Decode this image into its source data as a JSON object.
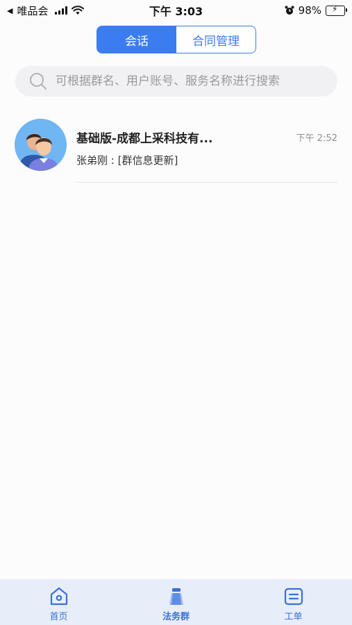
{
  "status_bar": {
    "back_app": "唯品会",
    "time": "下午 3:03",
    "battery": "98%",
    "battery_level": 0.98
  },
  "segmented": {
    "tabs": [
      {
        "label": "会话",
        "active": true
      },
      {
        "label": "合同管理",
        "active": false
      }
    ]
  },
  "search": {
    "placeholder": "可根据群名、用户账号、服务名称进行搜索"
  },
  "conversations": [
    {
      "title": "基础版-成都上采科技有...",
      "time": "下午 2:52",
      "preview": "张弟刚 : [群信息更新]"
    }
  ],
  "tab_bar": {
    "items": [
      {
        "label": "首页",
        "icon": "home-icon"
      },
      {
        "label": "法务群",
        "icon": "group-icon",
        "active": true
      },
      {
        "label": "工单",
        "icon": "ticket-icon"
      }
    ]
  },
  "colors": {
    "accent": "#3b7cf0",
    "tab_label": "#3b6fd6",
    "tab_bar_bg": "#e8eef9"
  }
}
